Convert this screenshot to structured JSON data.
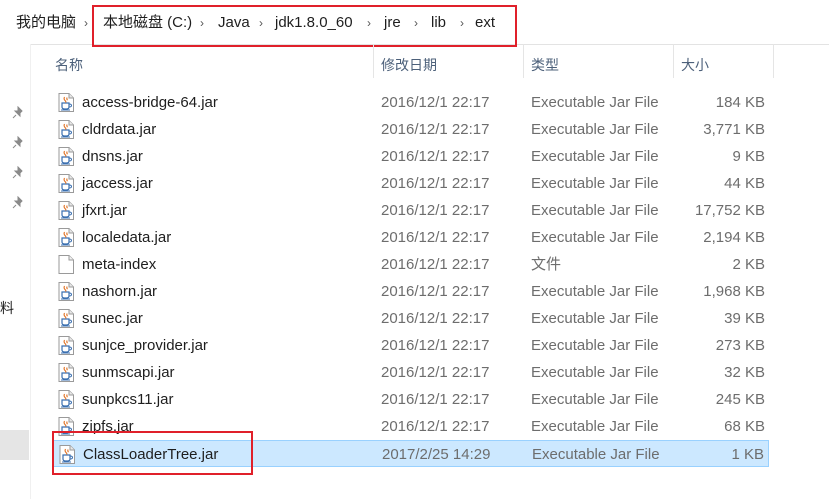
{
  "breadcrumb": {
    "items": [
      "我的电脑",
      "本地磁盘 (C:)",
      "Java",
      "jdk1.8.0_60",
      "jre",
      "lib",
      "ext"
    ]
  },
  "nav": {
    "partial_label": "料"
  },
  "columns": {
    "name": "名称",
    "date": "修改日期",
    "type": "类型",
    "size": "大小"
  },
  "files": [
    {
      "name": "access-bridge-64.jar",
      "date": "2016/12/1 22:17",
      "type": "Executable Jar File",
      "size": "184 KB",
      "icon": "jar-icon"
    },
    {
      "name": "cldrdata.jar",
      "date": "2016/12/1 22:17",
      "type": "Executable Jar File",
      "size": "3,771 KB",
      "icon": "jar-icon"
    },
    {
      "name": "dnsns.jar",
      "date": "2016/12/1 22:17",
      "type": "Executable Jar File",
      "size": "9 KB",
      "icon": "jar-icon"
    },
    {
      "name": "jaccess.jar",
      "date": "2016/12/1 22:17",
      "type": "Executable Jar File",
      "size": "44 KB",
      "icon": "jar-icon"
    },
    {
      "name": "jfxrt.jar",
      "date": "2016/12/1 22:17",
      "type": "Executable Jar File",
      "size": "17,752 KB",
      "icon": "jar-icon"
    },
    {
      "name": "localedata.jar",
      "date": "2016/12/1 22:17",
      "type": "Executable Jar File",
      "size": "2,194 KB",
      "icon": "jar-icon"
    },
    {
      "name": "meta-index",
      "date": "2016/12/1 22:17",
      "type": "文件",
      "size": "2 KB",
      "icon": "file-icon"
    },
    {
      "name": "nashorn.jar",
      "date": "2016/12/1 22:17",
      "type": "Executable Jar File",
      "size": "1,968 KB",
      "icon": "jar-icon"
    },
    {
      "name": "sunec.jar",
      "date": "2016/12/1 22:17",
      "type": "Executable Jar File",
      "size": "39 KB",
      "icon": "jar-icon"
    },
    {
      "name": "sunjce_provider.jar",
      "date": "2016/12/1 22:17",
      "type": "Executable Jar File",
      "size": "273 KB",
      "icon": "jar-icon"
    },
    {
      "name": "sunmscapi.jar",
      "date": "2016/12/1 22:17",
      "type": "Executable Jar File",
      "size": "32 KB",
      "icon": "jar-icon"
    },
    {
      "name": "sunpkcs11.jar",
      "date": "2016/12/1 22:17",
      "type": "Executable Jar File",
      "size": "245 KB",
      "icon": "jar-icon"
    },
    {
      "name": "zipfs.jar",
      "date": "2016/12/1 22:17",
      "type": "Executable Jar File",
      "size": "68 KB",
      "icon": "jar-icon"
    },
    {
      "name": "ClassLoaderTree.jar",
      "date": "2017/2/25 14:29",
      "type": "Executable Jar File",
      "size": "1 KB",
      "icon": "jar-icon",
      "selected": true
    }
  ],
  "colors": {
    "highlight_box": "#e0202a",
    "selection_bg": "#cce8ff",
    "header_text": "#4c607a"
  }
}
